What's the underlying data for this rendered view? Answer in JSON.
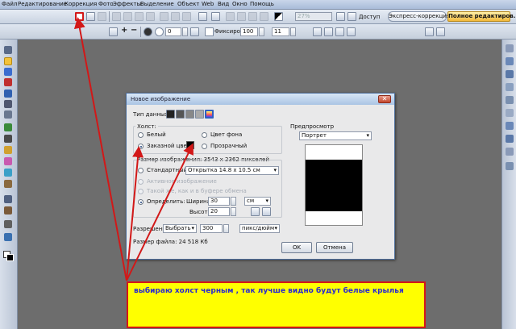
{
  "menu": {
    "items": [
      "Файл",
      "Редактирование",
      "Коррекция",
      "Фото",
      "Эффекты",
      "Выделение",
      "Объект",
      "Web",
      "Вид",
      "Окно",
      "Помощь"
    ]
  },
  "toolbar1": {
    "zoom": "27%",
    "access_label": "Доступ",
    "quick_fix": "Экспресс-коррекция",
    "full_edit": "Полное редактиров..."
  },
  "toolbar2": {
    "angle": "0",
    "fix_label": "Фиксировать",
    "size_value": "100",
    "count_value": "11"
  },
  "dialog": {
    "title": "Новое изображение",
    "data_type_label": "Тип данных:",
    "canvas_label": "Холст:",
    "white": "Белый",
    "bg_color": "Цвет фона",
    "custom_color": "Заказной цвет:",
    "transparent": "Прозрачный",
    "image_size": "Размер изображения: 3543 x 2362 пикселей",
    "standard": "Стандартный:",
    "standard_value": "Открытка 14.8 x 10.5 см",
    "active_image": "Активное изображение",
    "clipboard": "Такой же, как и в буфере обмена",
    "define": "Определить:",
    "width_label": "Ширина:",
    "width_value": "30",
    "height_label": "Высота:",
    "height_value": "20",
    "unit": "см",
    "resolution_label": "Разрешение:",
    "resolution_mode": "Выбрать",
    "resolution_value": "300",
    "resolution_unit": "пикс/дюйм",
    "file_size": "Размер файла:  24 518 Кб",
    "preview_label": "Предпросмотр",
    "orientation": "Портрет",
    "ok": "OK",
    "cancel": "Отмена",
    "canvas_color": "#000000"
  },
  "annotation": {
    "text": "выбираю холст черным , так лучше видно будут белые крылья",
    "color": "#ffff00"
  }
}
